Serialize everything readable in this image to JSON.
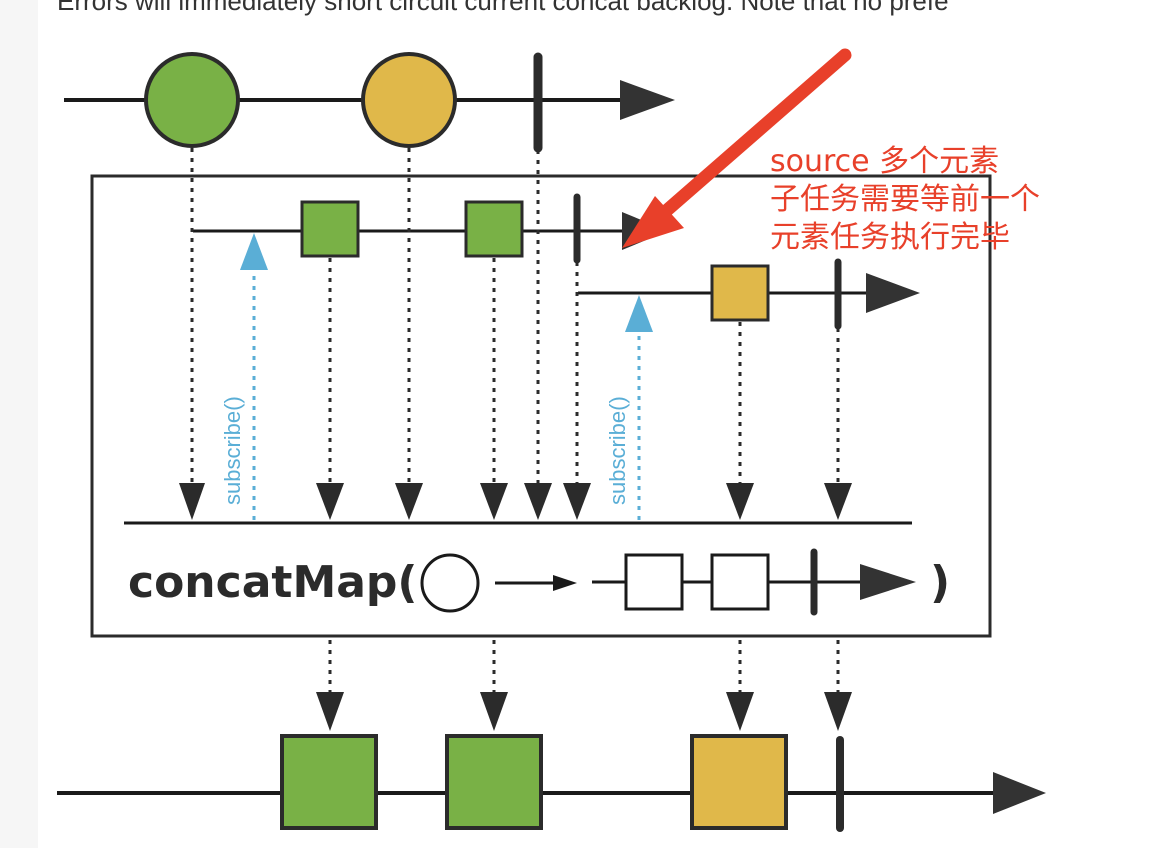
{
  "page": {
    "top_text": "Errors will immediately short circuit current concat backlog. Note that no prefe"
  },
  "diagram": {
    "operator_label": "concatMap(",
    "operator_close": ")",
    "subscribe_label": "subscribe()",
    "annotation": {
      "lines": [
        "source 多个元素",
        "子任务需要等前一个",
        "元素任务执行完毕"
      ],
      "color": "#e8402a"
    },
    "colors": {
      "green": "#79b146",
      "yellow": "#e0b84a",
      "line": "#1a1a1a",
      "dark": "#333333",
      "subscribe_blue": "#5aaed6"
    }
  }
}
